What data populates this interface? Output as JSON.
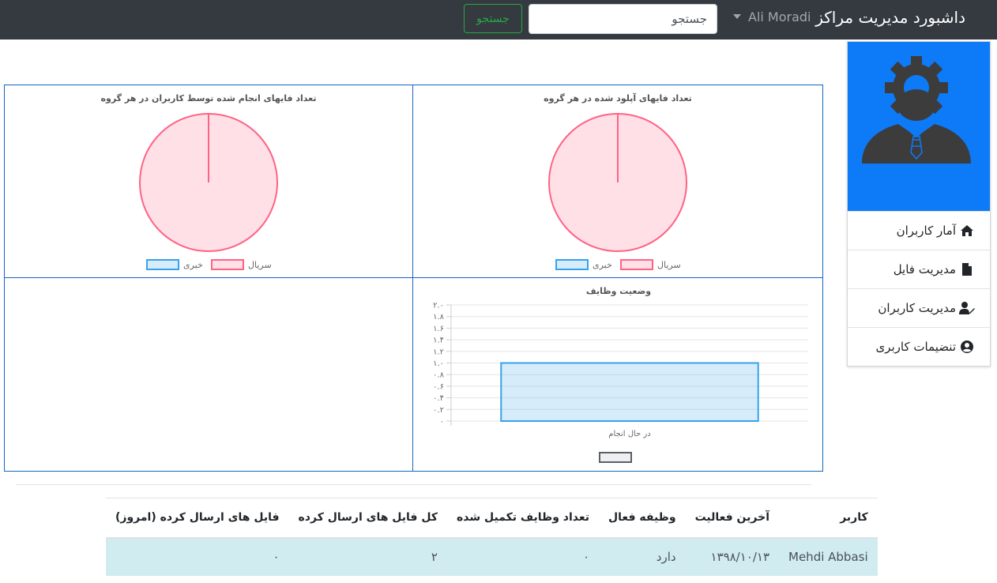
{
  "navbar": {
    "brand": "داشبورد مدیریت مراکز",
    "user": "Ali Moradi",
    "search_placeholder": "جستجو",
    "search_button": "جستجو"
  },
  "sidebar": {
    "items": [
      {
        "label": "آمار کاربران",
        "icon": "home-icon"
      },
      {
        "label": "مدیریت فایل",
        "icon": "file-icon"
      },
      {
        "label": "مدیریت کاربران",
        "icon": "user-edit-icon"
      },
      {
        "label": "تنضیمات کاربری",
        "icon": "user-circle-icon"
      }
    ]
  },
  "chart_data": [
    {
      "type": "pie",
      "title": "تعداد فایهای آپلود شده در هر گروه",
      "categories": [
        "سریال",
        "خبری"
      ],
      "values": [
        1,
        0
      ],
      "colors": {
        "سریال": "#ff6384",
        "خبری": "#36a2eb"
      },
      "legend_position": "bottom"
    },
    {
      "type": "pie",
      "title": "تعداد فایهای انجام شده توسط کاربران در هر گروه",
      "categories": [
        "سریال",
        "خبری"
      ],
      "values": [
        1,
        0
      ],
      "colors": {
        "سریال": "#ff6384",
        "خبری": "#36a2eb"
      },
      "legend_position": "bottom"
    },
    {
      "type": "bar",
      "title": "وضعیت وظایف",
      "categories": [
        "در حال انجام"
      ],
      "values": [
        1
      ],
      "ylim": [
        0,
        2
      ],
      "yticks": [
        "۰",
        "۰.۲",
        "۰.۴",
        "۰.۶",
        "۰.۸",
        "۱.۰",
        "۱.۲",
        "۱.۴",
        "۱.۶",
        "۱.۸",
        "۲.۰"
      ],
      "grid": true,
      "color": "#36a2eb",
      "legend_position": "bottom"
    }
  ],
  "table": {
    "headers": [
      "کاربر",
      "آخرین فعالیت",
      "وظیفه فعال",
      "تعداد وظایف تکمیل شده",
      "کل فایل های ارسال کرده",
      "فایل های ارسال کرده (امروز)"
    ],
    "rows": [
      [
        "Mehdi Abbasi",
        "۱۳۹۸/۱۰/۱۳",
        "دارد",
        "۰",
        "۲",
        "۰"
      ]
    ]
  }
}
